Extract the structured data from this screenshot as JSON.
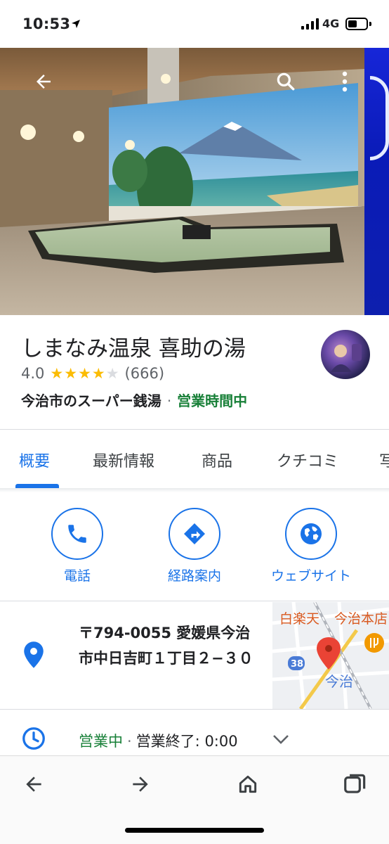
{
  "status_bar": {
    "time": "10:53",
    "network": "4G"
  },
  "hero": {
    "back_icon": "arrow-left-icon",
    "search_icon": "search-icon",
    "menu_icon": "more-vertical-icon"
  },
  "place": {
    "name": "しまなみ温泉 喜助の湯",
    "rating": "4.0",
    "stars_filled": 4,
    "stars_total": 5,
    "review_count": "(666)",
    "category": "今治市のスーパー銭湯",
    "separator": "·",
    "open_status": "営業時間中"
  },
  "tabs": [
    {
      "label": "概要",
      "active": true
    },
    {
      "label": "最新情報",
      "active": false
    },
    {
      "label": "商品",
      "active": false
    },
    {
      "label": "クチコミ",
      "active": false
    },
    {
      "label": "写",
      "active": false
    }
  ],
  "actions": [
    {
      "label": "電話",
      "icon": "phone-icon"
    },
    {
      "label": "経路案内",
      "icon": "directions-icon"
    },
    {
      "label": "ウェブサイト",
      "icon": "globe-icon"
    }
  ],
  "address": {
    "text": "〒794-0055 愛媛県今治市中日吉町１丁目２−３０",
    "icon": "location-pin-icon",
    "map": {
      "label_1": "白楽天",
      "label_2": "今治本店",
      "station_label": "今治",
      "route_number": "38"
    }
  },
  "hours": {
    "icon": "clock-icon",
    "status": "営業中",
    "separator": "·",
    "closing": "営業終了: 0:00",
    "expand_icon": "chevron-down-icon"
  },
  "toolbar": {
    "back_icon": "browser-back-icon",
    "forward_icon": "browser-forward-icon",
    "home_icon": "home-icon",
    "tabs_icon": "tabs-icon"
  },
  "colors": {
    "accent": "#1a73e8",
    "open": "#188038",
    "star": "#fbbc04"
  }
}
